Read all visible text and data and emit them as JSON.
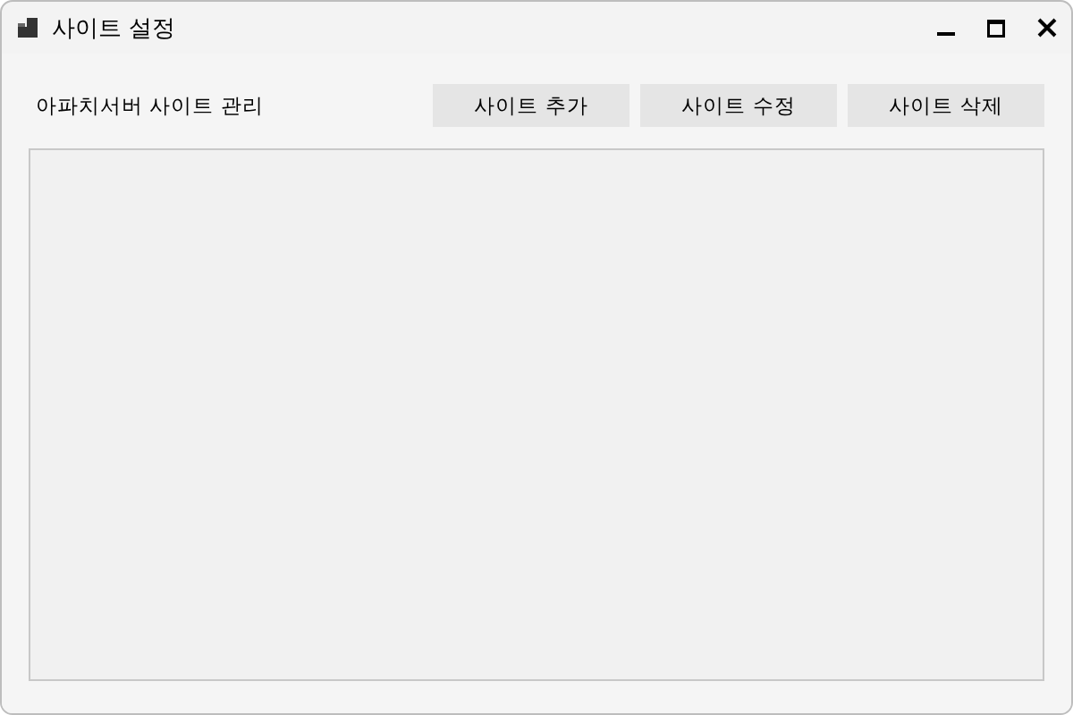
{
  "window": {
    "title": "사이트 설정"
  },
  "header": {
    "label": "아파치서버 사이트 관리"
  },
  "buttons": [
    "사이트 추가",
    "사이트 수정",
    "사이트 삭제"
  ]
}
